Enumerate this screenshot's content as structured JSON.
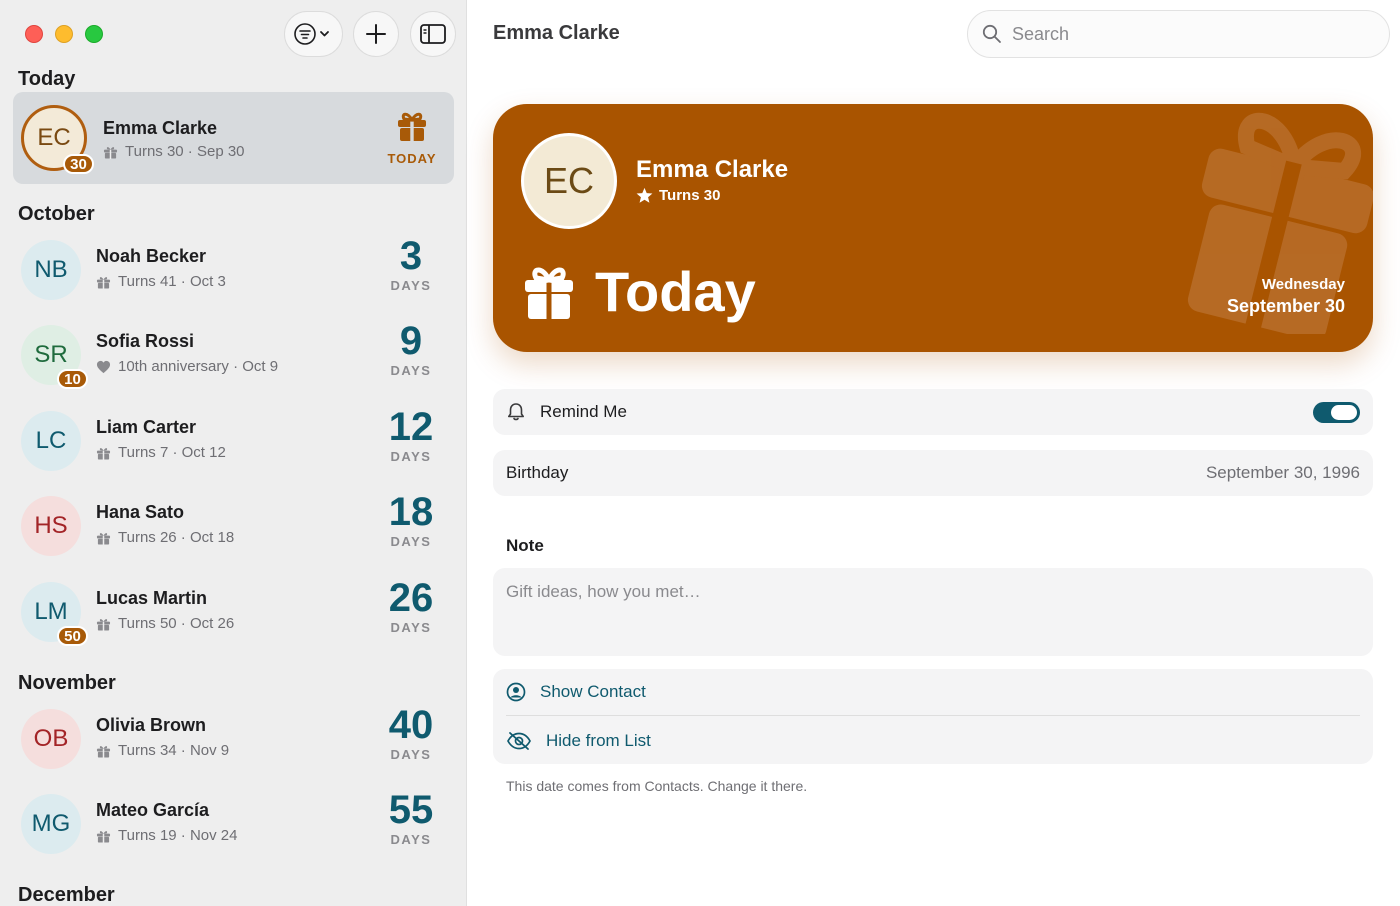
{
  "window": {
    "title": "Emma Clarke",
    "search_placeholder": "Search"
  },
  "toolbar": {
    "filter_icon": "filter-menu-icon",
    "add_icon": "plus-icon",
    "sidebar_icon": "sidebar-toggle-icon"
  },
  "sections": [
    {
      "title": "Today"
    },
    {
      "title": "October"
    },
    {
      "title": "November"
    },
    {
      "title": "December"
    }
  ],
  "rows": [
    {
      "initials": "EC",
      "name": "Emma Clarke",
      "detail": "Turns 30 · Sep 30",
      "badge": "30",
      "status": "TODAY",
      "icon": "gift-icon"
    },
    {
      "initials": "NB",
      "name": "Noah Becker",
      "detail": "Turns 41 · Oct 3",
      "days": "3",
      "days_label": "DAYS",
      "icon": "gift-icon",
      "avatar_bg": "#dcebef",
      "avatar_fg": "#0f5a6e"
    },
    {
      "initials": "SR",
      "name": "Sofia Rossi",
      "detail": "10th anniversary · Oct 9",
      "badge": "10",
      "days": "9",
      "days_label": "DAYS",
      "icon": "heart-icon",
      "avatar_bg": "#dfeee4",
      "avatar_fg": "#1f6b3d"
    },
    {
      "initials": "LC",
      "name": "Liam Carter",
      "detail": "Turns 7 · Oct 12",
      "days": "12",
      "days_label": "DAYS",
      "icon": "gift-icon",
      "avatar_bg": "#dcebef",
      "avatar_fg": "#0f5a6e"
    },
    {
      "initials": "HS",
      "name": "Hana Sato",
      "detail": "Turns 26 · Oct 18",
      "days": "18",
      "days_label": "DAYS",
      "icon": "gift-icon",
      "avatar_bg": "#f5dedd",
      "avatar_fg": "#a32427"
    },
    {
      "initials": "LM",
      "name": "Lucas Martin",
      "detail": "Turns 50 · Oct 26",
      "badge": "50",
      "days": "26",
      "days_label": "DAYS",
      "icon": "gift-icon",
      "avatar_bg": "#dcebef",
      "avatar_fg": "#0f5a6e"
    },
    {
      "initials": "OB",
      "name": "Olivia Brown",
      "detail": "Turns 34 · Nov 9",
      "days": "40",
      "days_label": "DAYS",
      "icon": "gift-icon",
      "avatar_bg": "#f5dedd",
      "avatar_fg": "#a32427"
    },
    {
      "initials": "MG",
      "name": "Mateo García",
      "detail": "Turns 19 · Nov 24",
      "days": "55",
      "days_label": "DAYS",
      "icon": "gift-icon",
      "avatar_bg": "#dcebef",
      "avatar_fg": "#0f5a6e"
    }
  ],
  "detail": {
    "initials": "EC",
    "name": "Emma Clarke",
    "milestone": "Turns 30",
    "headline": "Today",
    "weekday": "Wednesday",
    "date": "September 30",
    "remind_label": "Remind Me",
    "remind_on": true,
    "birthday_label": "Birthday",
    "birthday_value": "September 30, 1996",
    "note_title": "Note",
    "note_placeholder": "Gift ideas, how you met…",
    "show_contact": "Show Contact",
    "hide_from_list": "Hide from List",
    "footnote": "This date comes from Contacts. Change it there."
  },
  "colors": {
    "accent": "#0f5a6e",
    "hero": "#a95400",
    "badge": "#a85a08"
  }
}
